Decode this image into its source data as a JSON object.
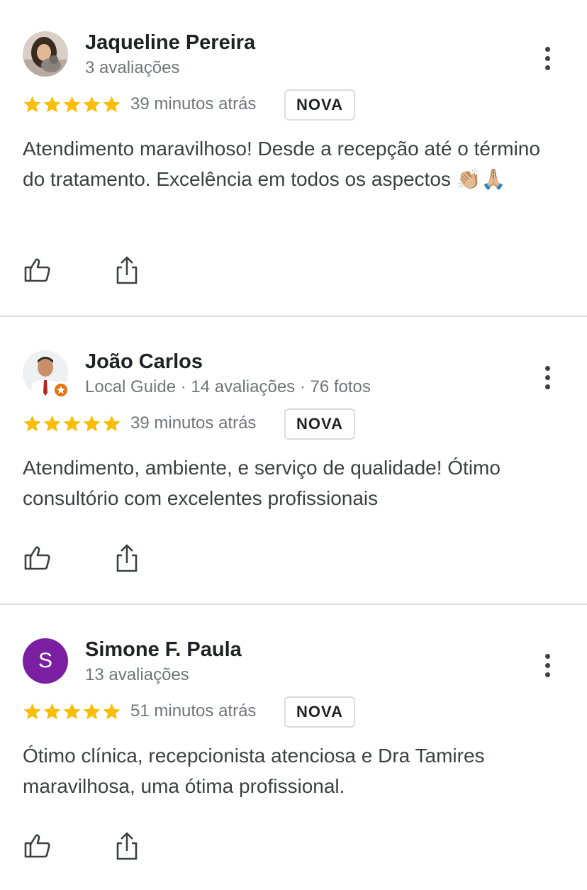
{
  "reviews": [
    {
      "name": "Jaqueline Pereira",
      "meta": "3 avaliações",
      "time": "39 minutos atrás",
      "tag": "NOVA",
      "text": "Atendimento maravilhoso! Desde a recepção até o término do tratamento. Excelência em todos os aspectos",
      "emoji": "👏🏼🙏🏼",
      "rating": 5,
      "avatar": "photo"
    },
    {
      "name": "João Carlos",
      "meta": "Local Guide · 14 avaliações · 76 fotos",
      "time": "39 minutos atrás",
      "tag": "NOVA",
      "text": "Atendimento, ambiente, e serviço de qualidade! Ótimo consultório com excelentes profissionais",
      "rating": 5,
      "avatar": "photo",
      "local_guide_badge": true
    },
    {
      "name": "Simone F. Paula",
      "meta": "13 avaliações",
      "time": "51 minutos atrás",
      "tag": "NOVA",
      "text": "Ótimo clínica, recepcionista atenciosa e Dra Tamires maravilhosa, uma ótima profissional.",
      "rating": 5,
      "avatar_letter": "S",
      "avatar_color": "#7b1fa2"
    }
  ],
  "colors": {
    "star": "#fbbc04",
    "divider": "#dadce0",
    "badge": "#e8710a"
  },
  "icons": {
    "like": "thumb-up-icon",
    "share": "share-icon",
    "menu": "more-vert-icon",
    "star": "star-icon"
  }
}
